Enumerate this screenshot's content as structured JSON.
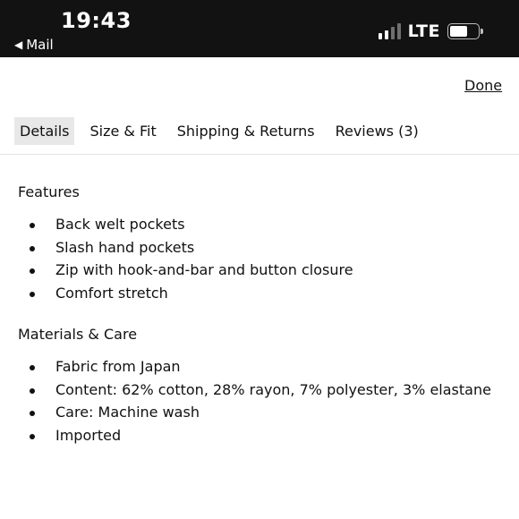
{
  "status_bar": {
    "time": "19:43",
    "back_label": "Mail",
    "network": "LTE"
  },
  "header": {
    "done_label": "Done"
  },
  "tabs": [
    {
      "label": "Details",
      "active": true
    },
    {
      "label": "Size & Fit",
      "active": false
    },
    {
      "label": "Shipping & Returns",
      "active": false
    },
    {
      "label": "Reviews (3)",
      "active": false
    }
  ],
  "features": {
    "title": "Features",
    "items": [
      "Back welt pockets",
      "Slash hand pockets",
      "Zip with hook-and-bar and button closure",
      "Comfort stretch"
    ]
  },
  "materials": {
    "title": "Materials & Care",
    "items": [
      "Fabric from Japan",
      "Content: 62% cotton, 28% rayon, 7% polyester, 3% elastane",
      "Care: Machine wash",
      "Imported"
    ]
  },
  "icons": {
    "back": "back-arrow-icon",
    "signal": "signal-icon",
    "battery": "battery-icon"
  },
  "colors": {
    "status_bar_bg": "#121212",
    "active_tab_bg": "#e8e8e8",
    "text": "#111111"
  }
}
